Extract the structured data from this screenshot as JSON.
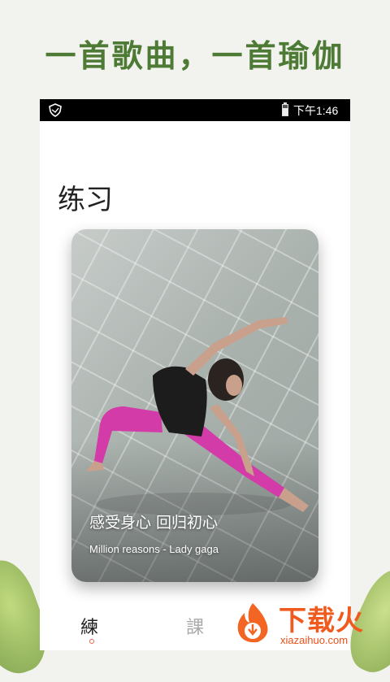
{
  "promo": {
    "headline": "一首歌曲，一首瑜伽"
  },
  "statusbar": {
    "time": "下午1:46"
  },
  "page": {
    "title": "练习"
  },
  "card": {
    "title": "感受身心 回归初心",
    "subtitle": "Million reasons - Lady gaga"
  },
  "tabs": [
    {
      "label": "練",
      "selected": true
    },
    {
      "label": "課",
      "selected": false
    }
  ],
  "watermark": {
    "brand": "下载火",
    "domain": "xiazaihuo.com"
  },
  "colors": {
    "headline": "#4d7a34",
    "tab_dot": "#e8624a",
    "watermark": "#f05a1e"
  }
}
